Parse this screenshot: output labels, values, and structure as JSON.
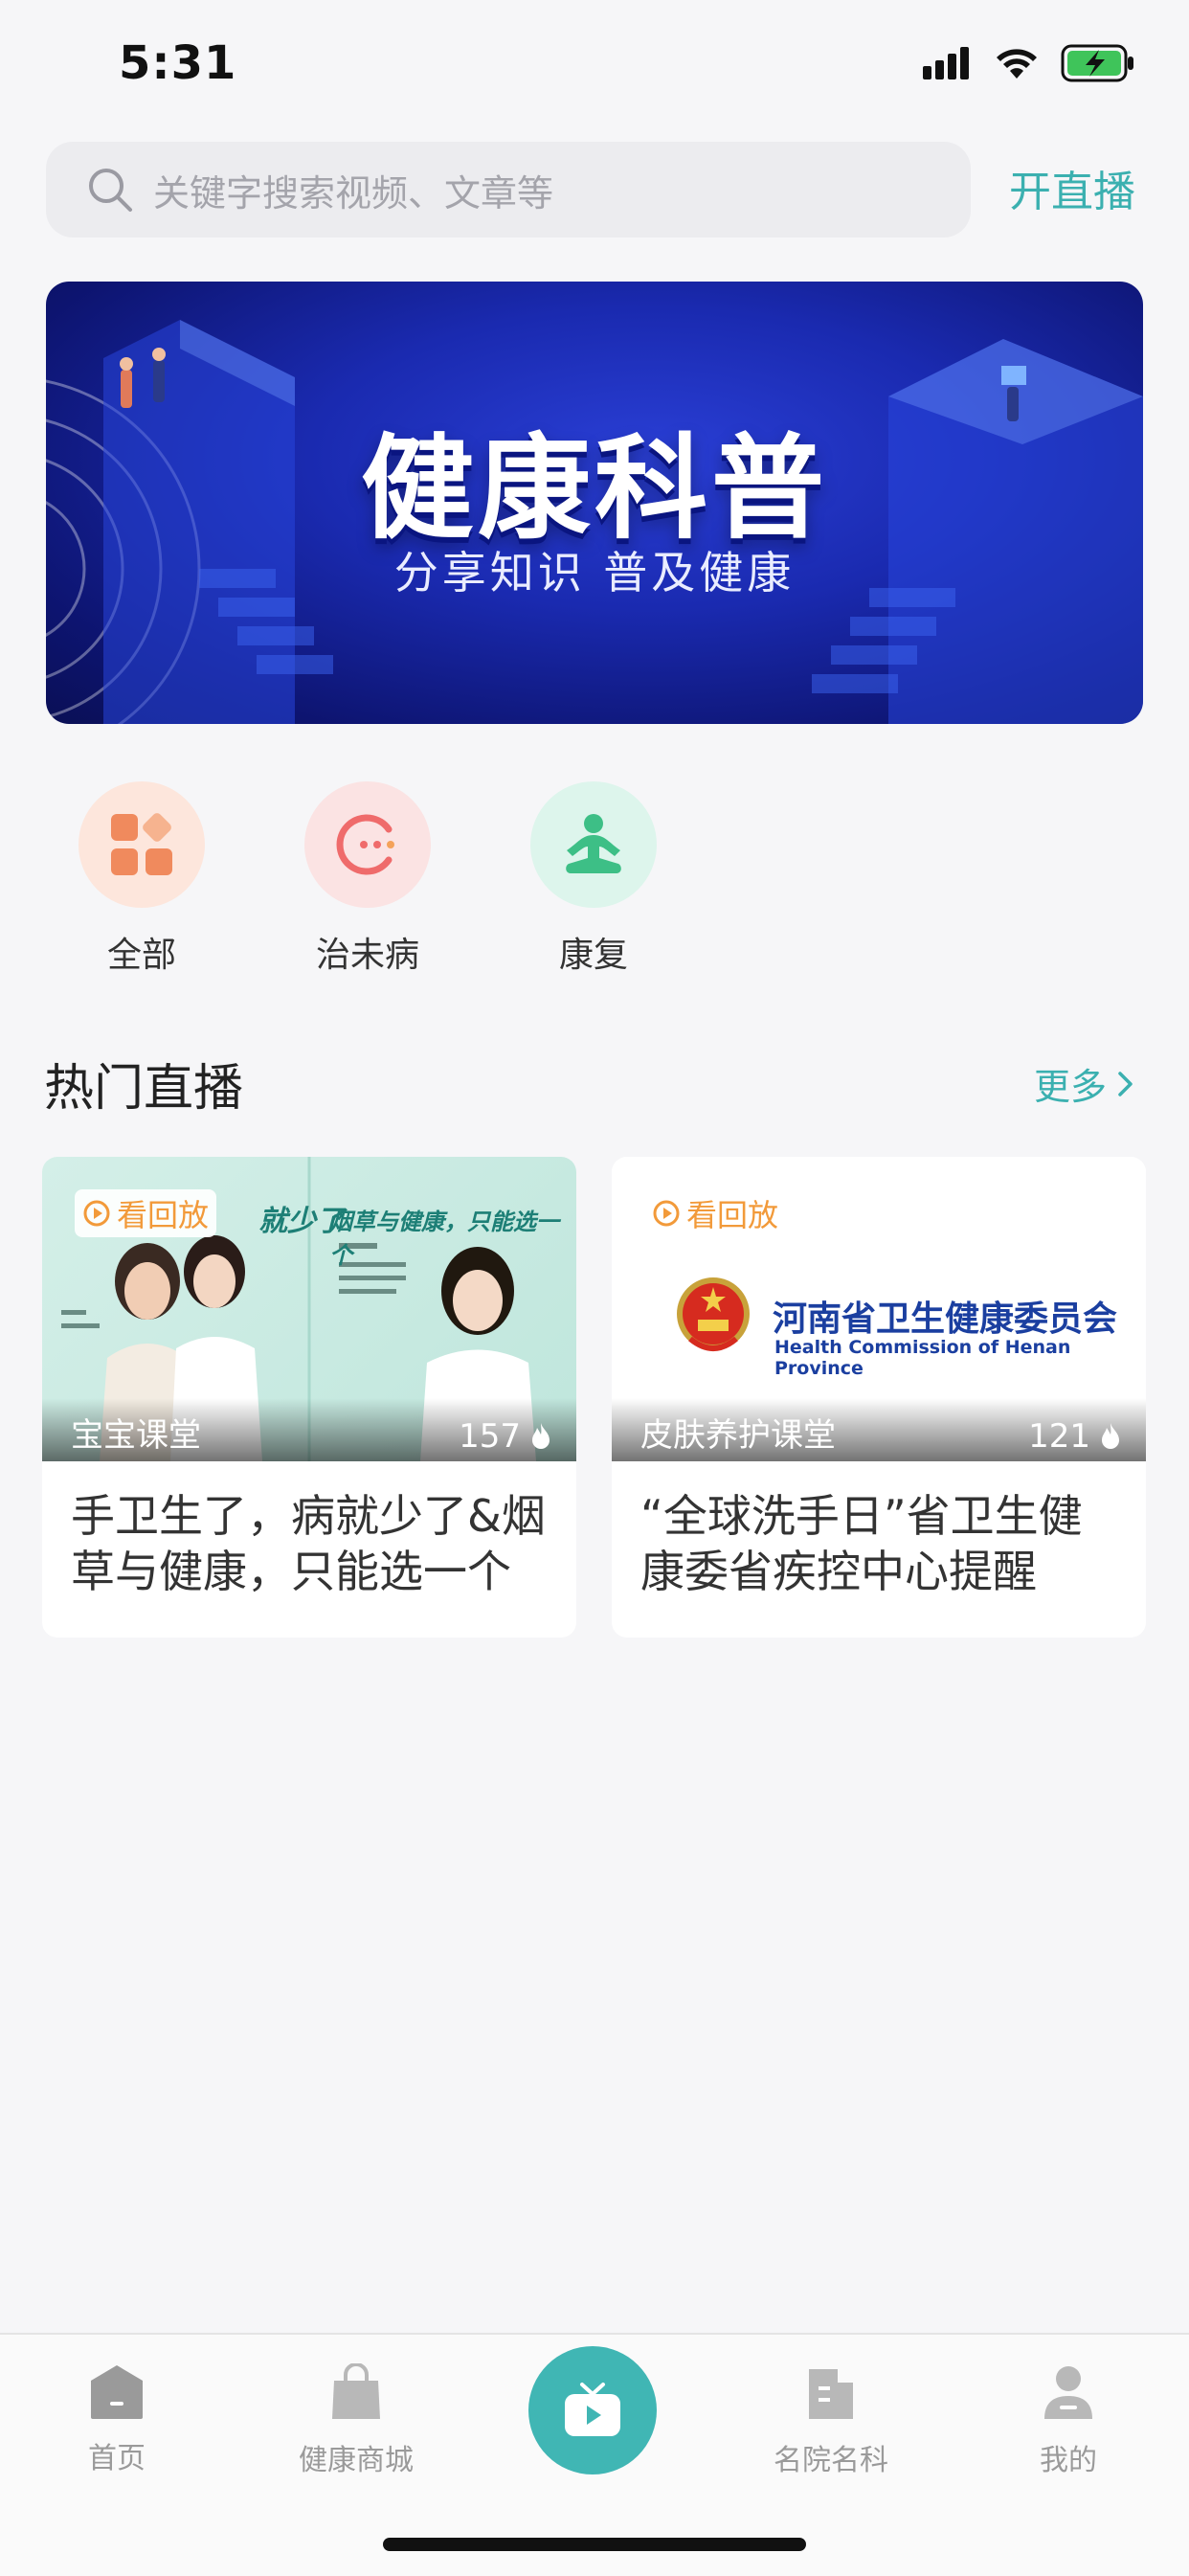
{
  "status_bar": {
    "time": "5:31"
  },
  "search": {
    "placeholder": "关键字搜索视频、文章等",
    "live_label": "开直播"
  },
  "banner": {
    "title": "健康科普",
    "subtitle": "分享知识 普及健康"
  },
  "categories": [
    {
      "label": "全部",
      "icon": "grid-icon"
    },
    {
      "label": "治未病",
      "icon": "face-icon"
    },
    {
      "label": "康复",
      "icon": "meditation-icon"
    }
  ],
  "section": {
    "title": "热门直播",
    "more": "更多"
  },
  "cards": [
    {
      "badge": "看回放",
      "category": "宝宝课堂",
      "views": "157",
      "title": "手卫生了，病就少了&烟草与健康，只能选一个",
      "thumb_texts": [
        "就少了",
        "烟草与健康，只能选一个"
      ]
    },
    {
      "badge": "看回放",
      "category": "皮肤养护课堂",
      "views": "121",
      "title": "“全球洗手日”省卫生健康委省疾控中心提醒",
      "org_name_cn": "河南省卫生健康委员会",
      "org_name_en": "Health Commission of Henan Province"
    }
  ],
  "tabbar": {
    "items": [
      {
        "label": "首页",
        "icon": "home-icon"
      },
      {
        "label": "健康商城",
        "icon": "shopping-bag-icon"
      },
      {
        "label": "",
        "icon": "tv-icon"
      },
      {
        "label": "名院名科",
        "icon": "building-icon"
      },
      {
        "label": "我的",
        "icon": "user-icon"
      }
    ]
  },
  "colors": {
    "accent": "#3bb0b0",
    "replay": "#f29a3a",
    "tab_center": "#40b6b4"
  }
}
